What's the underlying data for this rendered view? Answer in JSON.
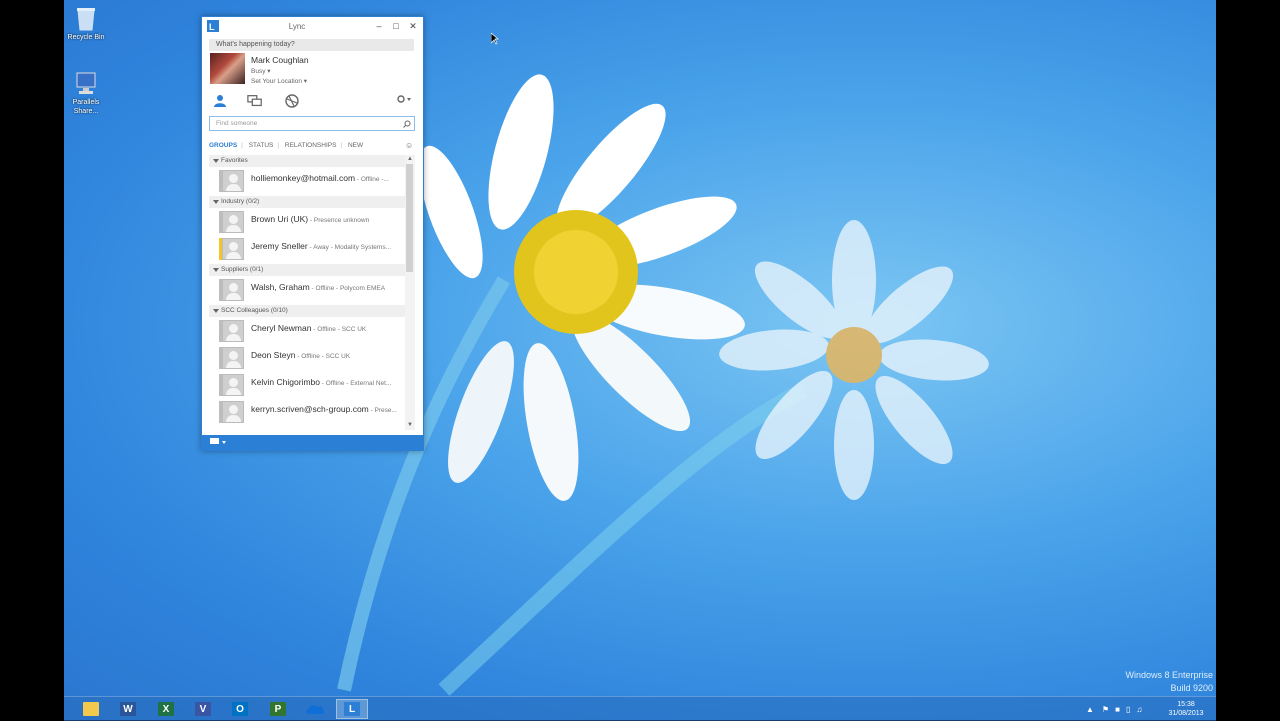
{
  "desktop": {
    "icons": [
      {
        "label": "Recycle Bin"
      },
      {
        "label_line1": "Parallels",
        "label_line2": "Share..."
      }
    ],
    "watermark": {
      "line1": "Windows 8 Enterprise",
      "line2": "Build 9200"
    }
  },
  "lync": {
    "title": "Lync",
    "note_placeholder": "What's happening today?",
    "me": {
      "name": "Mark Coughlan",
      "status": "Busy ▾",
      "location": "Set Your Location ▾"
    },
    "search_placeholder": "Find someone",
    "tabs": [
      {
        "label": "GROUPS"
      },
      {
        "label": "STATUS"
      },
      {
        "label": "RELATIONSHIPS"
      },
      {
        "label": "NEW"
      }
    ],
    "groups": [
      {
        "label": "Favorites",
        "contacts": [
          {
            "name": "holliemonkey@hotmail.com",
            "status": " - Offline -..."
          }
        ]
      },
      {
        "label": "Industry (0/2)",
        "contacts": [
          {
            "name": "Brown Uri (UK)",
            "status": " - Presence unknown"
          },
          {
            "name": "Jeremy Sneller",
            "status": " - Away - Modality Systems..."
          }
        ]
      },
      {
        "label": "Suppliers (0/1)",
        "contacts": [
          {
            "name": "Walsh, Graham",
            "status": " - Offline - Polycom EMEA"
          }
        ]
      },
      {
        "label": "SCC Colleagues (0/10)",
        "contacts": [
          {
            "name": "Cheryl Newman",
            "status": " - Offline - SCC UK"
          },
          {
            "name": "Deon Steyn",
            "status": " - Offline - SCC UK"
          },
          {
            "name": "Kelvin Chigorimbo",
            "status": " - Offline - External Net..."
          },
          {
            "name": "kerryn.scriven@sch-group.com",
            "status": " - Prese..."
          }
        ]
      }
    ]
  },
  "taskbar": {
    "apps": [
      "file-explorer",
      "word",
      "excel",
      "visio",
      "outlook",
      "project",
      "skydrive",
      "lync"
    ],
    "clock": {
      "time": "15:38",
      "date": "31/08/2013"
    }
  },
  "colors": {
    "accent": "#2b7fd4",
    "away": "#f4c524"
  }
}
